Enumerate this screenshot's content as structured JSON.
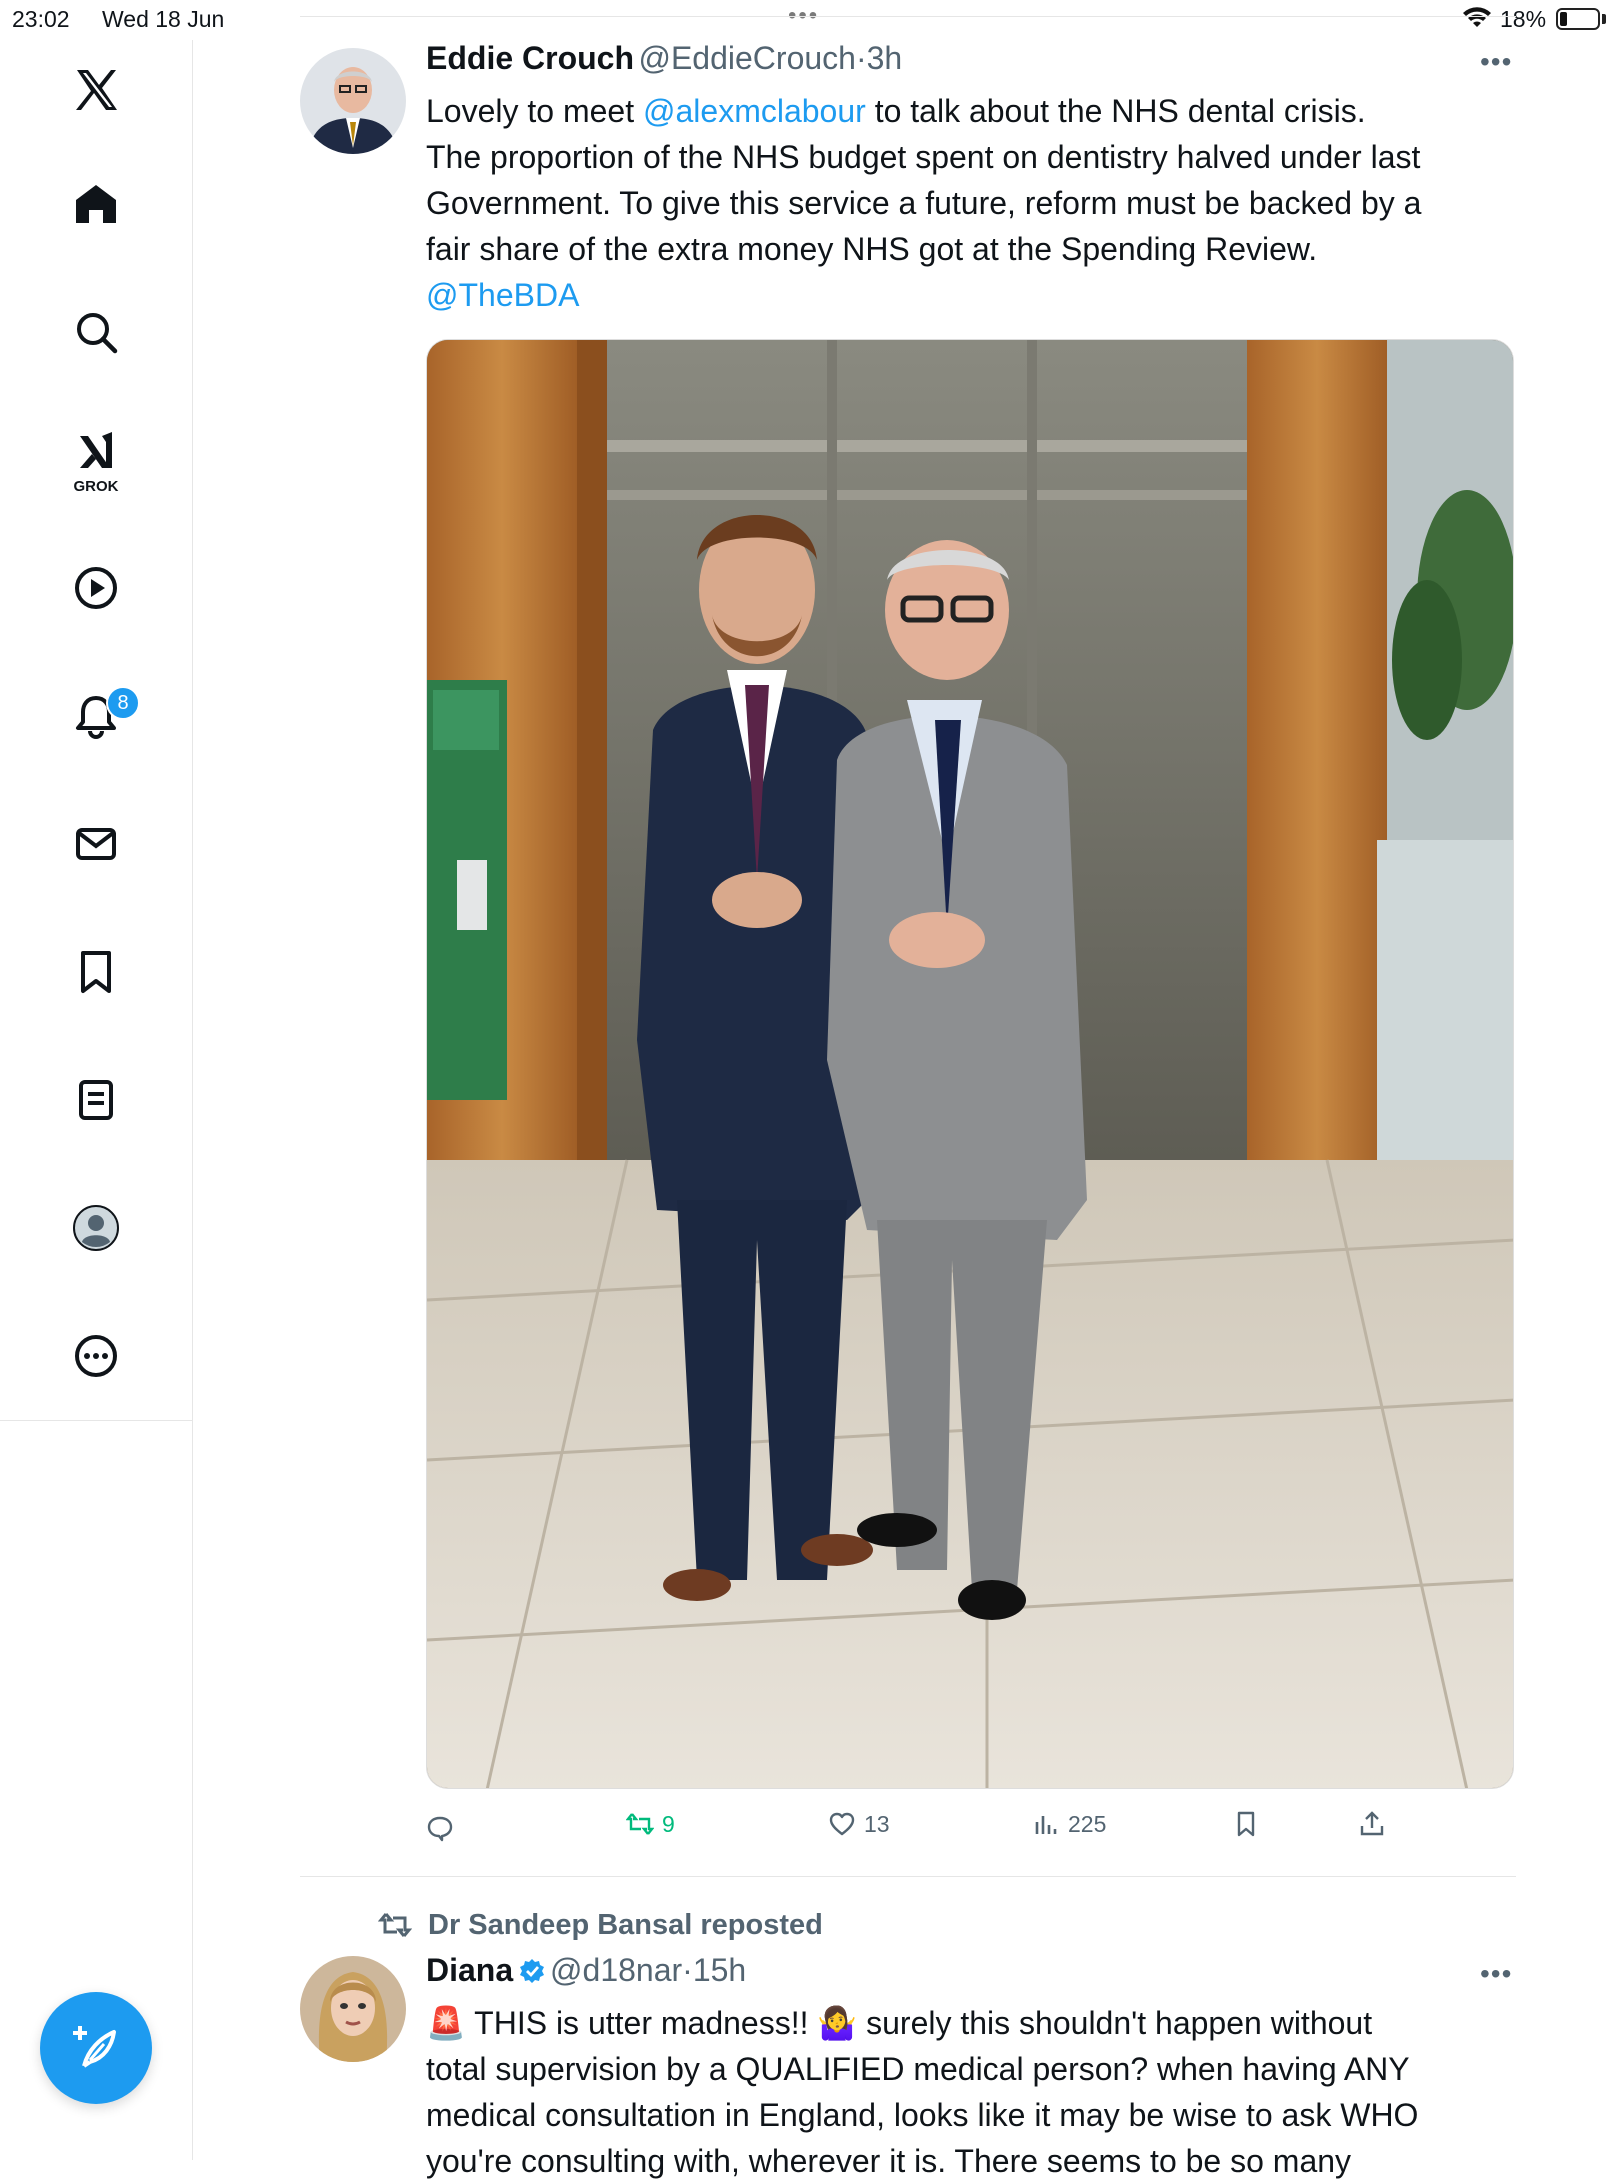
{
  "status_bar": {
    "time": "23:02",
    "date": "Wed 18 Jun",
    "battery": "18%",
    "center_dots": "•••"
  },
  "sidebar": {
    "items": [
      {
        "name": "x-logo",
        "label": ""
      },
      {
        "name": "home",
        "label": ""
      },
      {
        "name": "search",
        "label": ""
      },
      {
        "name": "grok",
        "label": "GROK"
      },
      {
        "name": "video",
        "label": ""
      },
      {
        "name": "notifications",
        "label": "",
        "badge": "8"
      },
      {
        "name": "messages",
        "label": ""
      },
      {
        "name": "bookmarks",
        "label": ""
      },
      {
        "name": "lists",
        "label": ""
      },
      {
        "name": "profile",
        "label": ""
      },
      {
        "name": "more",
        "label": ""
      }
    ]
  },
  "tweet1": {
    "name": "Eddie Crouch",
    "handle": "@EddieCrouch",
    "sep": "·",
    "time": "3h",
    "more": "•••",
    "body_line1_pre": "Lovely to meet ",
    "body_line1_mention": "@alexmclabour",
    "body_line1_post": " to talk about the NHS dental crisis.",
    "body_line2": "The proportion of the NHS budget spent on dentistry halved under last",
    "body_line3": "Government. To give this service a future, reform must be backed by a",
    "body_line4": "fair share of the extra money NHS got at the Spending Review.",
    "body_line5": "@TheBDA",
    "actions": {
      "replies": "",
      "reposts": "9",
      "likes": "13",
      "views": "225"
    }
  },
  "tweet2": {
    "repost_by": "Dr Sandeep Bansal reposted",
    "name": "Diana",
    "handle": "@d18nar",
    "sep": "·",
    "time": "15h",
    "more": "•••",
    "body_line1": "🚨 THIS is utter madness!! 🤷‍♀️  surely this shouldn't happen without",
    "body_line2": "total supervision by a QUALIFIED medical person? when having ANY",
    "body_line3": "medical consultation in England, looks like it may be wise to ask WHO",
    "body_line4": "you're consulting with, wherever it is. There seems to be so many"
  },
  "colors": {
    "accent": "#1d9bf0",
    "repost_green": "#00ba7c",
    "muted": "#536471"
  }
}
